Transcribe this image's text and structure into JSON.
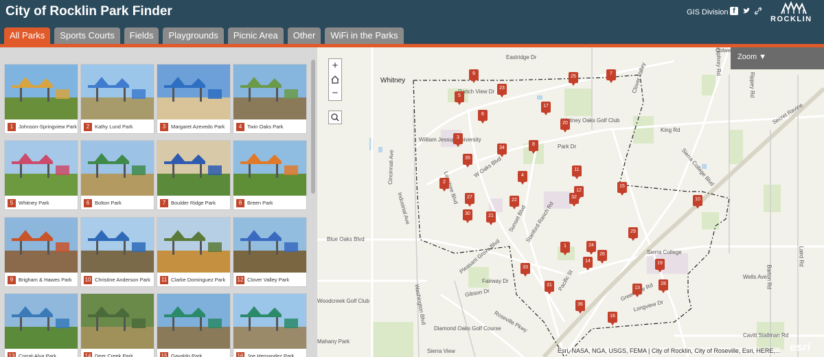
{
  "header": {
    "title": "City of Rocklin Park Finder",
    "gis_link": "GIS Division",
    "logo_text": "ROCKLIN"
  },
  "tabs": [
    {
      "label": "All Parks",
      "active": true
    },
    {
      "label": "Sports Courts",
      "active": false
    },
    {
      "label": "Fields",
      "active": false
    },
    {
      "label": "Playgrounds",
      "active": false
    },
    {
      "label": "Picnic Area",
      "active": false
    },
    {
      "label": "Other",
      "active": false
    },
    {
      "label": "WiFi in the Parks",
      "active": false
    }
  ],
  "parks": [
    {
      "num": "1",
      "name": "Johnson-Springview Park"
    },
    {
      "num": "2",
      "name": "Kathy Lund Park"
    },
    {
      "num": "3",
      "name": "Margaret Azevedo Park"
    },
    {
      "num": "4",
      "name": "Twin Oaks Park"
    },
    {
      "num": "5",
      "name": "Whitney Park"
    },
    {
      "num": "6",
      "name": "Bolton Park"
    },
    {
      "num": "7",
      "name": "Boulder Ridge Park"
    },
    {
      "num": "8",
      "name": "Breen Park"
    },
    {
      "num": "9",
      "name": "Brigham & Hawes Park"
    },
    {
      "num": "10",
      "name": "Christine Anderson Park"
    },
    {
      "num": "11",
      "name": "Clarke Dominguez Park"
    },
    {
      "num": "12",
      "name": "Clover Valley Park"
    },
    {
      "num": "13",
      "name": "Corral-Alva Park"
    },
    {
      "num": "14",
      "name": "Deer Creek Park"
    },
    {
      "num": "15",
      "name": "Gayaldo Park"
    },
    {
      "num": "16",
      "name": "Joe Hernandez Park"
    }
  ],
  "map": {
    "zoom_label": "Zoom ▼",
    "zoom_in": "+",
    "zoom_out": "−",
    "attribution": "Esri, NASA, NGA, USGS, FEMA | City of Rocklin, City of Roseville, Esri, HERE,...",
    "esri_logo": "esri",
    "labels": [
      "Whitney",
      "Eastridge Dr",
      "Ranch View Dr",
      "Clover Valley",
      "Colwell",
      "Whitney Oaks Golf Club",
      "William Jessup University",
      "King Rd",
      "Secret Ravine",
      "Sierra College Blvd",
      "Park Dr",
      "W Oaks Blvd",
      "Cincinnati Ave",
      "Industrial Ave",
      "Lonetree Blvd",
      "Blue Oaks Blvd",
      "Sunset Blvd",
      "Stanford Ranch Rd",
      "Sierra College",
      "Woodcreek Golf Club",
      "Pleasant Grove Blvd",
      "Fairway Dr",
      "Gibson Dr",
      "Roseville Pkwy",
      "Washington Blvd",
      "Diamond Oaks Golf Course",
      "Pacific St",
      "Wells Ave",
      "Barton Rd",
      "Laird Rd",
      "Cavitt Stallman Rd",
      "Humphrey Rd",
      "Rippey Rd",
      "Sierra View",
      "Greenbrae Rd",
      "Longview Dr",
      "Mahany Park"
    ],
    "pins": [
      "9",
      "25",
      "7",
      "23",
      "5",
      "17",
      "6",
      "20",
      "3",
      "34",
      "8",
      "35",
      "4",
      "11",
      "2",
      "12",
      "15",
      "27",
      "22",
      "32",
      "10",
      "30",
      "21",
      "29",
      "1",
      "24",
      "26",
      "14",
      "19",
      "33",
      "31",
      "13",
      "28",
      "36",
      "16"
    ]
  }
}
